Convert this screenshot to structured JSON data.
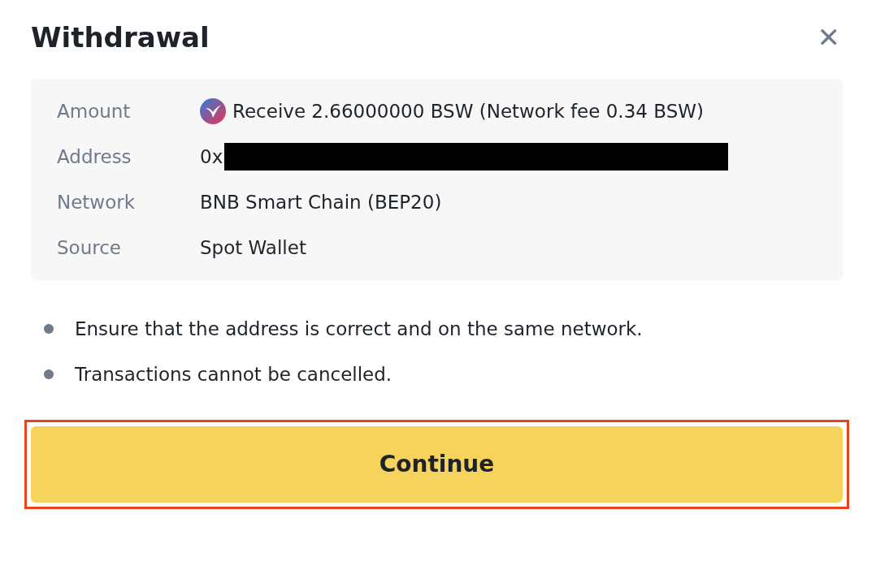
{
  "dialog": {
    "title": "Withdrawal",
    "close": "✕"
  },
  "details": [
    {
      "label": "Amount",
      "value": "Receive 2.66000000 BSW (Network fee 0.34 BSW)",
      "kind": "coin"
    },
    {
      "label": "Address",
      "value": "0x",
      "kind": "redacted"
    },
    {
      "label": "Network",
      "value": "BNB Smart Chain (BEP20)",
      "kind": "text"
    },
    {
      "label": "Source",
      "value": "Spot Wallet",
      "kind": "text"
    }
  ],
  "notes": [
    "Ensure that the address is correct and on the same network.",
    "Transactions cannot be cancelled."
  ],
  "button": {
    "label": "Continue",
    "highlighted": true
  }
}
